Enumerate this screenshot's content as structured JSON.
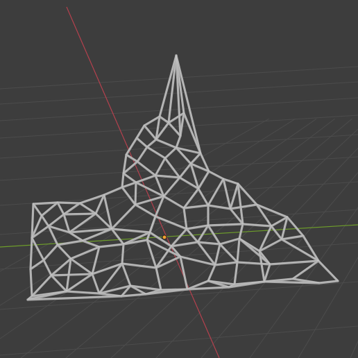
{
  "viewport": {
    "background_color": "#3d3d3d",
    "grid_color": "#4c4c4c",
    "x_axis_color": "#b5414e",
    "y_axis_color": "#6e9e2a",
    "wire_color": "#a9a9a9",
    "wire_highlight_color": "#d0d0d0",
    "origin_color": "#f0a030"
  },
  "object": {
    "shape": "terrain-mesh",
    "display_mode": "wireframe"
  },
  "markers": {
    "origin_icon": "object-origin-dot"
  }
}
